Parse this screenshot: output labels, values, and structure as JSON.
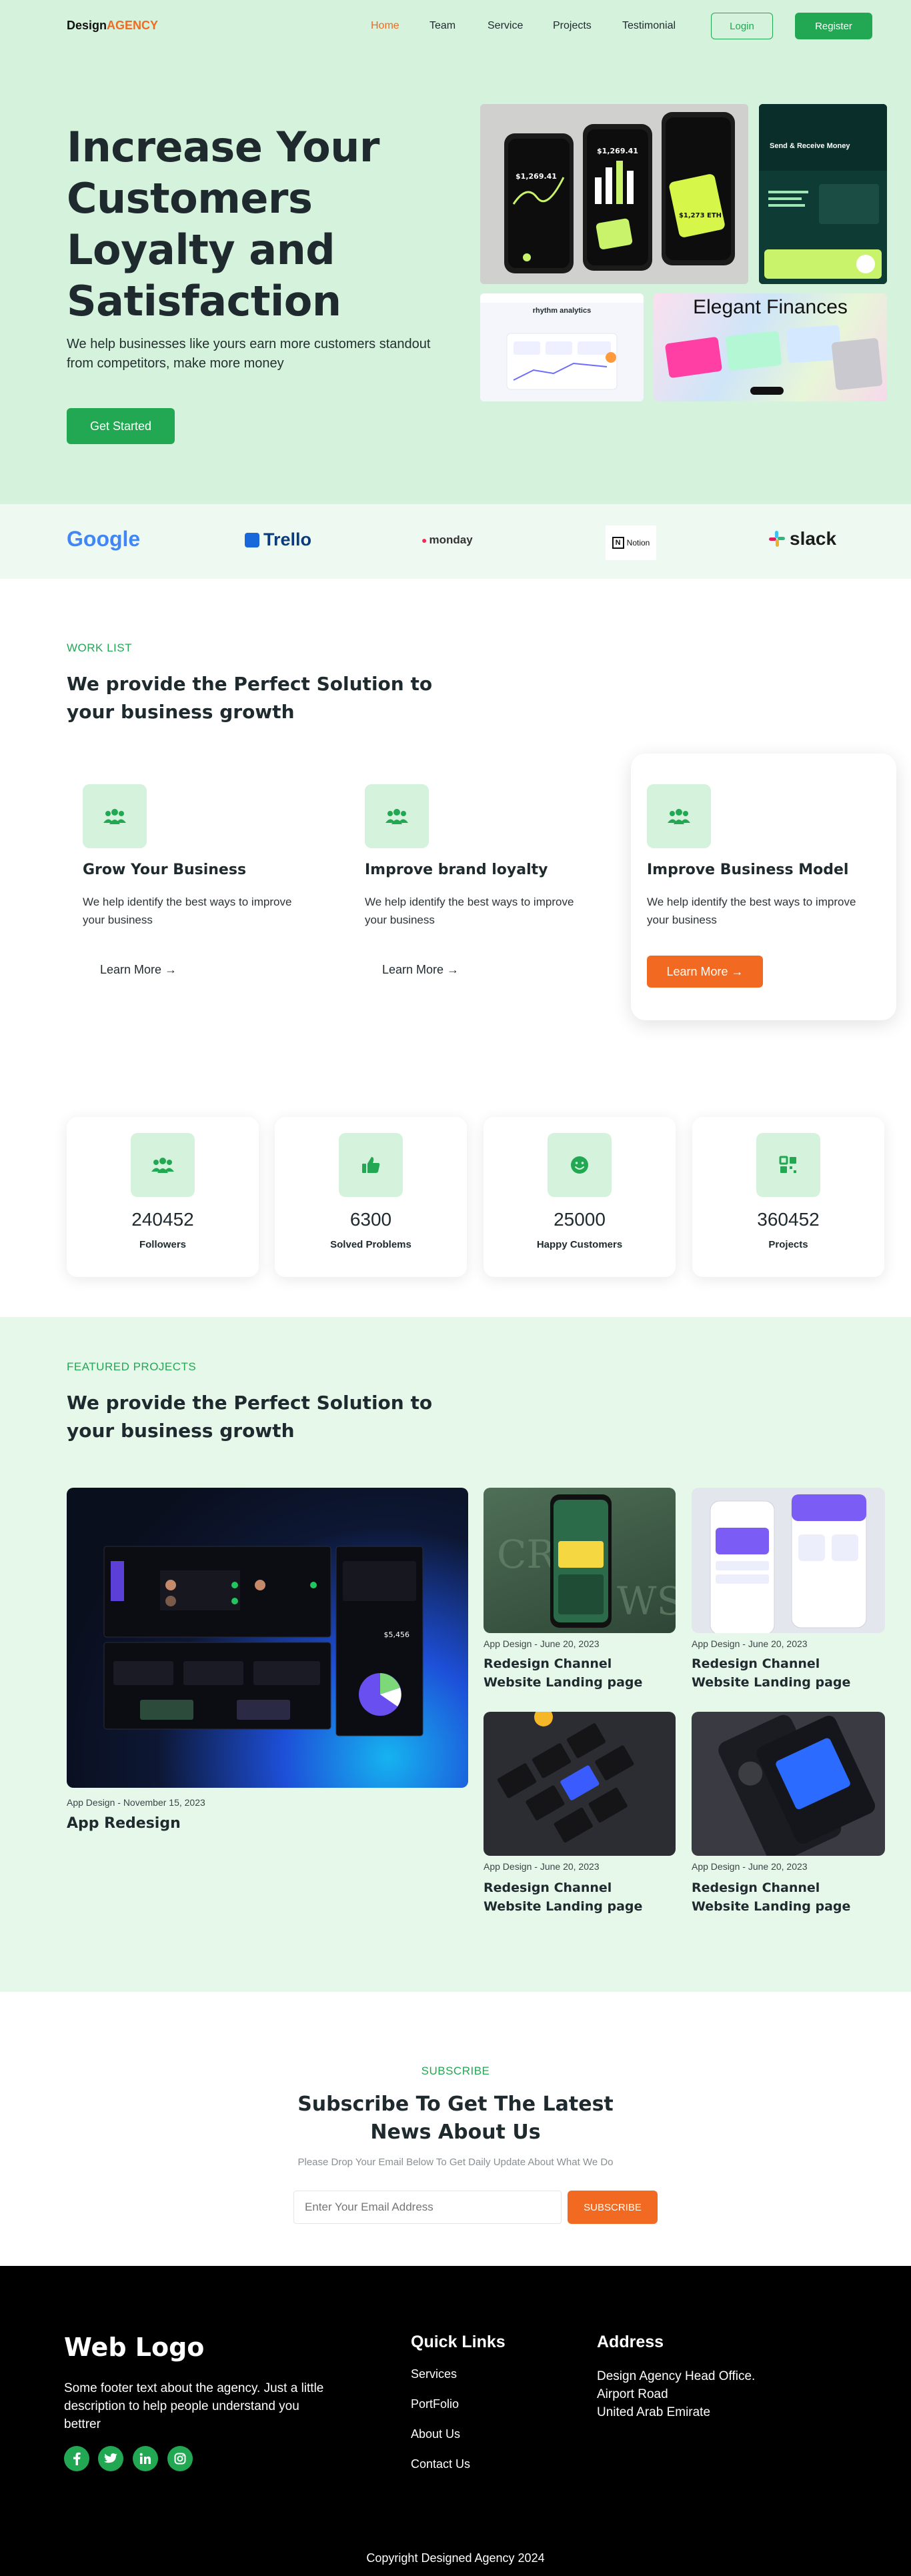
{
  "header": {
    "logo_main": "Design",
    "logo_accent": "AGENCY",
    "nav": [
      "Home",
      "Team",
      "Service",
      "Projects",
      "Testimonial"
    ],
    "login_label": "Login",
    "register_label": "Register",
    "colors": {
      "brand_green": "#22a852",
      "accent_orange": "#f26a21",
      "hero_bg": "#d4f2dc"
    }
  },
  "hero": {
    "title": "Increase Your Customers Loyalty and Satisfaction",
    "subtitle": "We help businesses like yours earn more customers standout from competitors, make more money",
    "cta_label": "Get Started",
    "preview": {
      "balance": "$1,269.41",
      "eth": "$1,273 ETH",
      "teal_card_title": "Send & Receive Money",
      "analytics_title": "rhythm analytics",
      "finance_title": "Elegant Finances"
    }
  },
  "brands": [
    "Google",
    "Trello",
    "monday",
    "Notion",
    "slack"
  ],
  "work": {
    "eyebrow": "WORK LIST",
    "title": "We provide the Perfect Solution to your business growth",
    "cards": [
      {
        "title": "Grow Your Business",
        "text": "We help identify the best ways to improve your business",
        "link": "Learn More →",
        "icon": "users-icon"
      },
      {
        "title": "Improve brand loyalty",
        "text": "We help identify the best ways to improve your business",
        "link": "Learn More →",
        "icon": "users-icon"
      },
      {
        "title": "Improve Business Model",
        "text": "We help identify the best ways to improve your business",
        "link": "Learn More →",
        "icon": "users-icon"
      }
    ]
  },
  "stats": [
    {
      "value": "240452",
      "label": "Followers",
      "icon": "users-icon"
    },
    {
      "value": "6300",
      "label": "Solved Problems",
      "icon": "thumbs-up-icon"
    },
    {
      "value": "25000",
      "label": "Happy Customers",
      "icon": "smile-icon"
    },
    {
      "value": "360452",
      "label": "Projects",
      "icon": "grid-icon"
    }
  ],
  "featured": {
    "eyebrow": "FEATURED PROJECTS",
    "title": "We provide the Perfect Solution to your business growth",
    "main": {
      "meta": "App Design - November 15, 2023",
      "title": "App Redesign",
      "panel_amount": "$5,456"
    },
    "items": [
      {
        "meta": "App Design - June 20, 2023",
        "title": "Redesign Channel Website Landing page"
      },
      {
        "meta": "App Design - June 20, 2023",
        "title": "Redesign Channel Website Landing page"
      },
      {
        "meta": "App Design - June 20, 2023",
        "title": "Redesign Channel Website Landing page"
      },
      {
        "meta": "App Design - June 20, 2023",
        "title": "Redesign Channel Website Landing page"
      }
    ]
  },
  "subscribe": {
    "eyebrow": "SUBSCRIBE",
    "title": "Subscribe To Get The Latest News About Us",
    "desc": "Please Drop Your Email Below To Get Daily Update About What We Do",
    "placeholder": "Enter Your Email Address",
    "button": "SUBSCRIBE"
  },
  "footer": {
    "logo": "Web Logo",
    "text": "Some footer text about the agency. Just a little description to help people understand you bettrer",
    "social": [
      "facebook-icon",
      "twitter-icon",
      "linkedin-icon",
      "instagram-icon"
    ],
    "links_title": "Quick Links",
    "links": [
      "Services",
      "PortFolio",
      "About Us",
      "Contact Us"
    ],
    "address_title": "Address",
    "address": [
      "Design Agency Head Office.",
      "Airport Road",
      "United Arab Emirate"
    ],
    "copyright": "Copyright Designed Agency 2024"
  }
}
